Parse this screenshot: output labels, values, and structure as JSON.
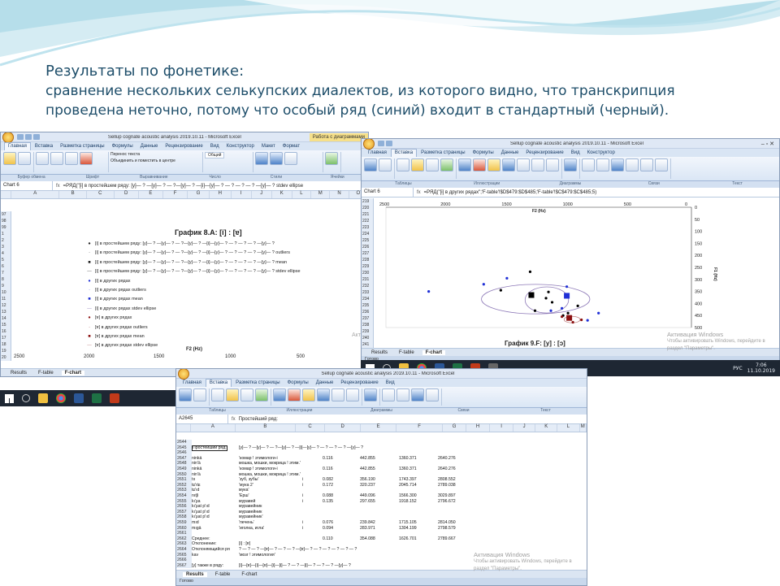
{
  "slide": {
    "title_line1": "Результаты по фонетике:",
    "title_line2": "сравнение  нескольких селькупских диалектов, из которого видно, что транскрипция",
    "title_line3": "проведена  неточно, потому что особый ряд (синий)  входит в стандартный (черный)."
  },
  "colors": {
    "accent_blue": "#1e4e6a",
    "excel_ribbon": "#dae6f5",
    "series_black": "#000000",
    "series_blue": "#1f2fd6",
    "series_darkred": "#8b1010",
    "ellipse_purple": "#8e7ab8"
  },
  "window1": {
    "title": "Sellup cognate acoustic analysis 2019.10.11 - Microsoft Excel",
    "context_tab": "Работа с диаграммами",
    "tabs": [
      "Главная",
      "Вставка",
      "Разметка страницы",
      "Формулы",
      "Данные",
      "Рецензирование",
      "Вид",
      "Конструктор",
      "Макет",
      "Формат"
    ],
    "ribbon_cmds": [
      "Вставить",
      "Перенос текста",
      "Общий",
      "Условное форматирование",
      "Форматировать как таблицу",
      "Стили ячеек",
      "Вставить"
    ],
    "groups": [
      "Буфер обмена",
      "Шрифт",
      "Выравнивание",
      "Число",
      "Стили",
      "Ячейки"
    ],
    "merge_label": "Объединить и поместить в центре",
    "namebox": "Chart 6",
    "formula": "=РЯД(\"[i] в простейшем ряду: [y]— ? —[y]— ? — ?—[y]— ? —[i]—[y]— ? — ? — ? — ? —[y]— ?  stdev ellipse",
    "columns": [
      "A",
      "B",
      "C",
      "D",
      "E",
      "F",
      "G",
      "H",
      "I",
      "J",
      "K",
      "L",
      "M",
      "N",
      "O"
    ],
    "rows": [
      "97",
      "98",
      "99",
      "1",
      "2",
      "3",
      "4",
      "5",
      "6",
      "7",
      "8",
      "9",
      "10",
      "11",
      "12",
      "13",
      "14",
      "15",
      "16",
      "17",
      "18",
      "19",
      "20"
    ],
    "chart_title": "График 8.A:  [i] : [ɐ]",
    "legend": [
      "[i] в простейшем ряду: [y]— ? —[y]— ? — ?—[y]— ? —[i]—[y]— ? — ? — ? — ? —[y]— ?",
      "[i] в простейшем ряду: [y]— ? —[y]— ? — ?—[y]— ? —[i]—[y]— ? — ? — ? — ? —[y]— ? outliers",
      "[i] в простейшем ряду: [y]— ? —[y]— ? — ?—[y]— ? —[i]—[y]— ? — ? — ? — ? —[y]— ? mean",
      "[i] в простейшем ряду: [y]— ? —[y]— ? — ?—[y]— ? —[i]—[y]— ? — ? — ? — ? —[y]— ? stdev ellipse",
      "[i] в других рядах",
      "[i] в других рядах outliers",
      "[i] в других рядах mean",
      "[i] в других рядах stdev ellipse",
      "[ɐ] в других рядах",
      "[ɐ] в других рядах outliers",
      "[ɐ] в других рядах mean",
      "[ɐ] в других рядах stdev ellipse"
    ],
    "xaxis_title": "F2 (Hz)",
    "xticks": [
      "2500",
      "2000",
      "1500",
      "1000",
      "500"
    ],
    "sheet_tabs": [
      "Results",
      "F-table",
      "F-chart"
    ],
    "partial_text": "Акт"
  },
  "window2": {
    "title": "Sellup cognate acoustic analysis 2019.10.11 - Microsoft Excel",
    "tabs": [
      "Главная",
      "Вставка",
      "Разметка страницы",
      "Формулы",
      "Данные",
      "Рецензирование",
      "Вид",
      "Конструктор"
    ],
    "ribbon_cmds": [
      "Сводная таблица",
      "Таблица",
      "Рисунок",
      "Клип",
      "Фигуры",
      "SmartArt",
      "Гистограмма",
      "График",
      "Круговая",
      "Линейчатая",
      "С областями",
      "Точечная",
      "Другие диаграммы",
      "Гиперссылка",
      "Надпись",
      "Колонтитулы",
      "WordArt",
      "Строка подписи",
      "Объект",
      "Символ"
    ],
    "groups": [
      "Таблицы",
      "Иллюстрации",
      "Диаграммы",
      "Связи",
      "Текст"
    ],
    "namebox": "Chart 6",
    "formula": "=РЯД(\"[i] в других рядах\";'F-table'!$D$479:$D$485;'F-table'!$C$479:$C$485;5)",
    "rows": [
      "219",
      "220",
      "221",
      "222",
      "223",
      "224",
      "225",
      "226",
      "227",
      "228",
      "229",
      "230",
      "231",
      "232",
      "233",
      "234",
      "235",
      "236",
      "237",
      "238",
      "239",
      "240",
      "241",
      "242"
    ],
    "sheet_tabs": [
      "Results",
      "F-table",
      "F-chart"
    ],
    "chart_title": "График 9.F:  [y] : [ɔ]",
    "status": "Готово"
  },
  "chart_data": {
    "type": "scatter",
    "title": "График 9.F:  [y] : [ɔ]",
    "xlabel": "F2 (Hz)",
    "ylabel": "F1 (Hz)",
    "x_ticks": [
      "2500",
      "2000",
      "1500",
      "1000",
      "500",
      "0"
    ],
    "y_ticks": [
      "0",
      "50",
      "100",
      "150",
      "200",
      "250",
      "300",
      "350",
      "400",
      "450",
      "500"
    ],
    "xlim": [
      2500,
      0
    ],
    "ylim": [
      0,
      500
    ],
    "x_reversed": true,
    "y_reversed": true,
    "series": [
      {
        "color": "#000000",
        "points": [
          [
            1320,
            268
          ],
          [
            1560,
            345
          ],
          [
            1280,
            430
          ],
          [
            1190,
            378
          ],
          [
            1140,
            395
          ],
          [
            1050,
            450
          ],
          [
            930,
            410
          ],
          [
            1170,
            352
          ],
          [
            1010,
            440
          ]
        ]
      },
      {
        "color": "#1f2fd6",
        "points": [
          [
            2150,
            350
          ],
          [
            1700,
            320
          ],
          [
            1020,
            330
          ],
          [
            850,
            470
          ],
          [
            760,
            440
          ],
          [
            1060,
            420
          ],
          [
            1510,
            295
          ],
          [
            1150,
            430
          ]
        ]
      },
      {
        "color": "#8b1010",
        "points": [
          [
            1060,
            455
          ],
          [
            970,
            478
          ],
          [
            900,
            468
          ]
        ]
      }
    ],
    "means": [
      {
        "color": "#000000",
        "x": 1310,
        "y": 365
      },
      {
        "color": "#1f2fd6",
        "x": 1020,
        "y": 368
      },
      {
        "color": "#8b1010",
        "x": 1000,
        "y": 460
      }
    ]
  },
  "clock": {
    "time": "7:06",
    "date": "11.10.2019",
    "lang": "РУС"
  },
  "window3": {
    "title": "Sellup cognate acoustic analysis 2019.10.11 - Microsoft Excel",
    "tabs": [
      "Главная",
      "Вставка",
      "Разметка страницы",
      "Формулы",
      "Данные",
      "Рецензирование",
      "Вид"
    ],
    "ribbon_cmds": [
      "Сводная таблица",
      "Таблица",
      "Рисунок",
      "Клип",
      "Фигуры",
      "SmartArt",
      "Гистограмма",
      "График",
      "Круговая",
      "Линейчатая",
      "С областями",
      "Точечная",
      "Другие диаграммы",
      "Гиперссылка",
      "Надпись",
      "Колонтитулы",
      "WordArt",
      "Строка подписи",
      "Объект",
      "Символ"
    ],
    "groups": [
      "Таблицы",
      "Иллюстрации",
      "Диаграммы",
      "Связи",
      "Текст"
    ],
    "namebox": "A2645",
    "formula": "Простейший ряд:",
    "columns": [
      "A",
      "B",
      "C",
      "D",
      "E",
      "F",
      "G",
      "H",
      "I",
      "J",
      "K",
      "L",
      "M"
    ],
    "rows": [
      {
        "n": "2644",
        "a": "",
        "b": "",
        "c": "",
        "d": "",
        "e": "",
        "f": "",
        "g": ""
      },
      {
        "n": "2645",
        "a": "Простейший ряд:",
        "b": "[y]— ? —[y]— ? — ?—[y]— ? —[i]—[y]— ? — ? — ? — ? —[y]— ?",
        "c": "",
        "d": "",
        "e": "",
        "f": "",
        "g": ""
      },
      {
        "n": "2646",
        "a": "",
        "b": "",
        "c": "",
        "d": "",
        "e": "",
        "f": "",
        "g": ""
      },
      {
        "n": "2647",
        "a": "ninkä",
        "b": "'комар ! этимологи-і",
        "c": "",
        "d": "0.116",
        "e": "442.855",
        "f": "1360.371",
        "g": "2640.276"
      },
      {
        "n": "2648",
        "a": "nin'ä",
        "b": "мошка, мошки, мокрица ! этим.'",
        "c": "",
        "d": "",
        "e": "",
        "f": "",
        "g": ""
      },
      {
        "n": "2649",
        "a": "ninkä",
        "b": "'комар ! этимологи-і",
        "c": "",
        "d": "0.116",
        "e": "442.855",
        "f": "1360.371",
        "g": "2640.276"
      },
      {
        "n": "2650",
        "a": "nin'ä",
        "b": "мошка, мошки, мокрица ! этим.'",
        "c": "",
        "d": "",
        "e": "",
        "f": "",
        "g": ""
      },
      {
        "n": "2651",
        "a": "tıı",
        "b": "'зуб, зубы'",
        "c": "i",
        "d": "0.082",
        "e": "356.190",
        "f": "1743.397",
        "g": "2808.552"
      },
      {
        "n": "2652",
        "a": "tɕ'ıtɕ",
        "b": "'мука 2'",
        "c": "i",
        "d": "0.172",
        "e": "320.237",
        "f": "2045.714",
        "g": "2789.038"
      },
      {
        "n": "2653",
        "a": "tɕ'ıd",
        "b": "мука'",
        "c": "",
        "d": "",
        "e": "",
        "f": "",
        "g": ""
      },
      {
        "n": "2654",
        "a": "nıtʃi",
        "b": "'Ерш'",
        "c": "i",
        "d": "0.088",
        "e": "449.096",
        "f": "1566.300",
        "g": "3029.897"
      },
      {
        "n": "2655",
        "a": "kı'ʂa",
        "b": "муравей",
        "c": "i",
        "d": "0.135",
        "e": "297.655",
        "f": "1918.152",
        "g": "2796.672"
      },
      {
        "n": "2656",
        "a": "kı'ʂat p'ıd",
        "b": "муравейник",
        "c": "",
        "d": "",
        "e": "",
        "f": "",
        "g": ""
      },
      {
        "n": "2657",
        "a": "kı'ʂat p'ıd",
        "b": "муравейник",
        "c": "",
        "d": "",
        "e": "",
        "f": "",
        "g": ""
      },
      {
        "n": "2658",
        "a": "kı'ʂat p'ıd",
        "b": "муравейник'",
        "c": "",
        "d": "",
        "e": "",
        "f": "",
        "g": ""
      },
      {
        "n": "2659",
        "a": "mıd",
        "b": "'печень'",
        "c": "i",
        "d": "0.076",
        "e": "239.842",
        "f": "1715.105",
        "g": "2814.050"
      },
      {
        "n": "2660",
        "a": "mıgä",
        "b": "'иголка, игла'",
        "c": "i",
        "d": "0.094",
        "e": "283.971",
        "f": "1304.199",
        "g": "2798.579"
      },
      {
        "n": "2661",
        "a": "",
        "b": "",
        "c": "",
        "d": "",
        "e": "",
        "f": "",
        "g": ""
      },
      {
        "n": "2662",
        "a": "Среднее:",
        "b": "",
        "c": "",
        "d": "0.110",
        "e": "354.088",
        "f": "1626.701",
        "g": "2789.667"
      },
      {
        "n": "2663",
        "a": "Отклонение:",
        "b": "[i] : [ɐ]",
        "c": "",
        "d": "",
        "e": "",
        "f": "",
        "g": ""
      },
      {
        "n": "2664",
        "a": "Отклоняющийся ря",
        "b": "? — ? — ? —[ɐ]— ? — ? — ? —[ɐ]— ? — ? — ? — ? — ? — ?",
        "c": "",
        "d": "",
        "e": "",
        "f": "",
        "g": ""
      },
      {
        "n": "2665",
        "a": "kav",
        "b": "'мозг ! этимология'",
        "c": "",
        "d": "",
        "e": "",
        "f": "",
        "g": ""
      },
      {
        "n": "2666",
        "a": "",
        "b": "",
        "c": "",
        "d": "",
        "e": "",
        "f": "",
        "g": ""
      },
      {
        "n": "2667",
        "a": "[y] также в ряду:",
        "b": "[i]—[ɐ]—[i]—[ɐ]—[i]—[i]— ? — ? —[i]— ? — ? — ? —[y]— ?",
        "c": "",
        "d": "",
        "e": "",
        "f": "",
        "g": ""
      }
    ],
    "sheet_tabs": [
      "Results",
      "F-table",
      "F-chart"
    ],
    "status": "Готово"
  },
  "watermarks": {
    "line1": "Активация Windows",
    "line2": "Чтобы активировать Windows, перейдите в",
    "line3": "раздел \"Параметры\"."
  }
}
